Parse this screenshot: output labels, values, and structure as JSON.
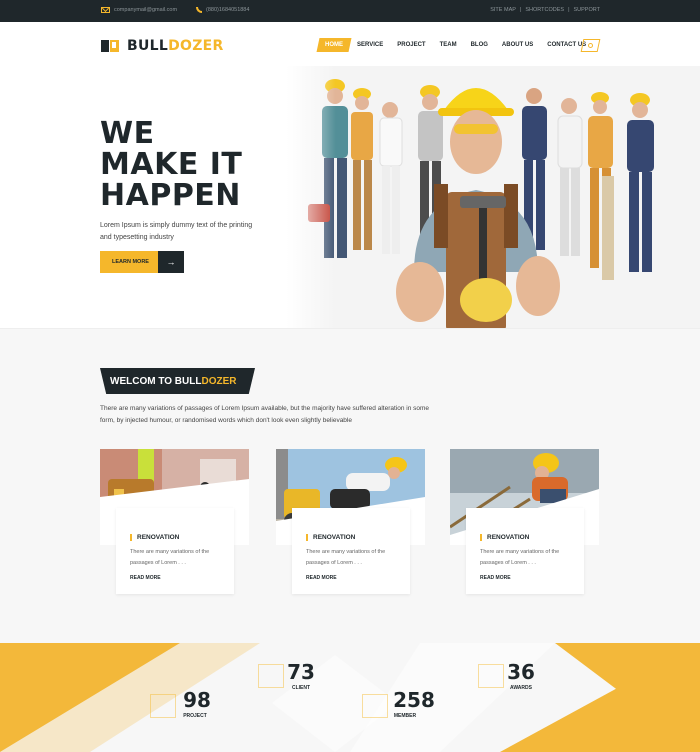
{
  "topbar": {
    "email": "companymail@gmail.com",
    "phone": "(880)1684051884",
    "links": [
      "SITE MAP",
      "|",
      "SHORTCODES",
      "|",
      "SUPPORT"
    ]
  },
  "brand": {
    "name_part1": "BULL",
    "name_part2": "DOZER",
    "accent_color": "#f5b72b",
    "dark_color": "#1f272b"
  },
  "nav": {
    "items": [
      "HOME",
      "SERVICE",
      "PROJECT",
      "TEAM",
      "BLOG",
      "ABOUT US",
      "CONTACT US"
    ],
    "active": "HOME",
    "search_icon": "search-icon"
  },
  "hero": {
    "headline_line1": "WE",
    "headline_line2": "MAKE IT",
    "headline_line3": "HAPPEN",
    "lead": "Lorem Ipsum is simply dummy text of the printing and typesetting industry",
    "cta_label": "LEARN MORE",
    "cta_icon": "arrow-right-icon"
  },
  "welcome": {
    "title_part1": "WELCOM TO BULL",
    "title_part2": "DOZER",
    "intro": "There are many variations of passages of Lorem Ipsum available, but the majority have suffered alteration in some form, by injected humour, or randomised words which don't look even slightly believable"
  },
  "cards": [
    {
      "title": "RENOVATION",
      "desc": "There are many variations of the passages of Lorem . . .",
      "link": "READ MORE"
    },
    {
      "title": "RENOVATION",
      "desc": "There are many variations of the passages of Lorem . . .",
      "link": "READ MORE"
    },
    {
      "title": "RENOVATION",
      "desc": "There are many variations of the passages of Lorem . . .",
      "link": "READ MORE"
    }
  ],
  "stats": [
    {
      "value": "98",
      "label": "PROJECT"
    },
    {
      "value": "73",
      "label": "CLIENT"
    },
    {
      "value": "258",
      "label": "MEMBER"
    },
    {
      "value": "36",
      "label": "AWARDS"
    }
  ]
}
